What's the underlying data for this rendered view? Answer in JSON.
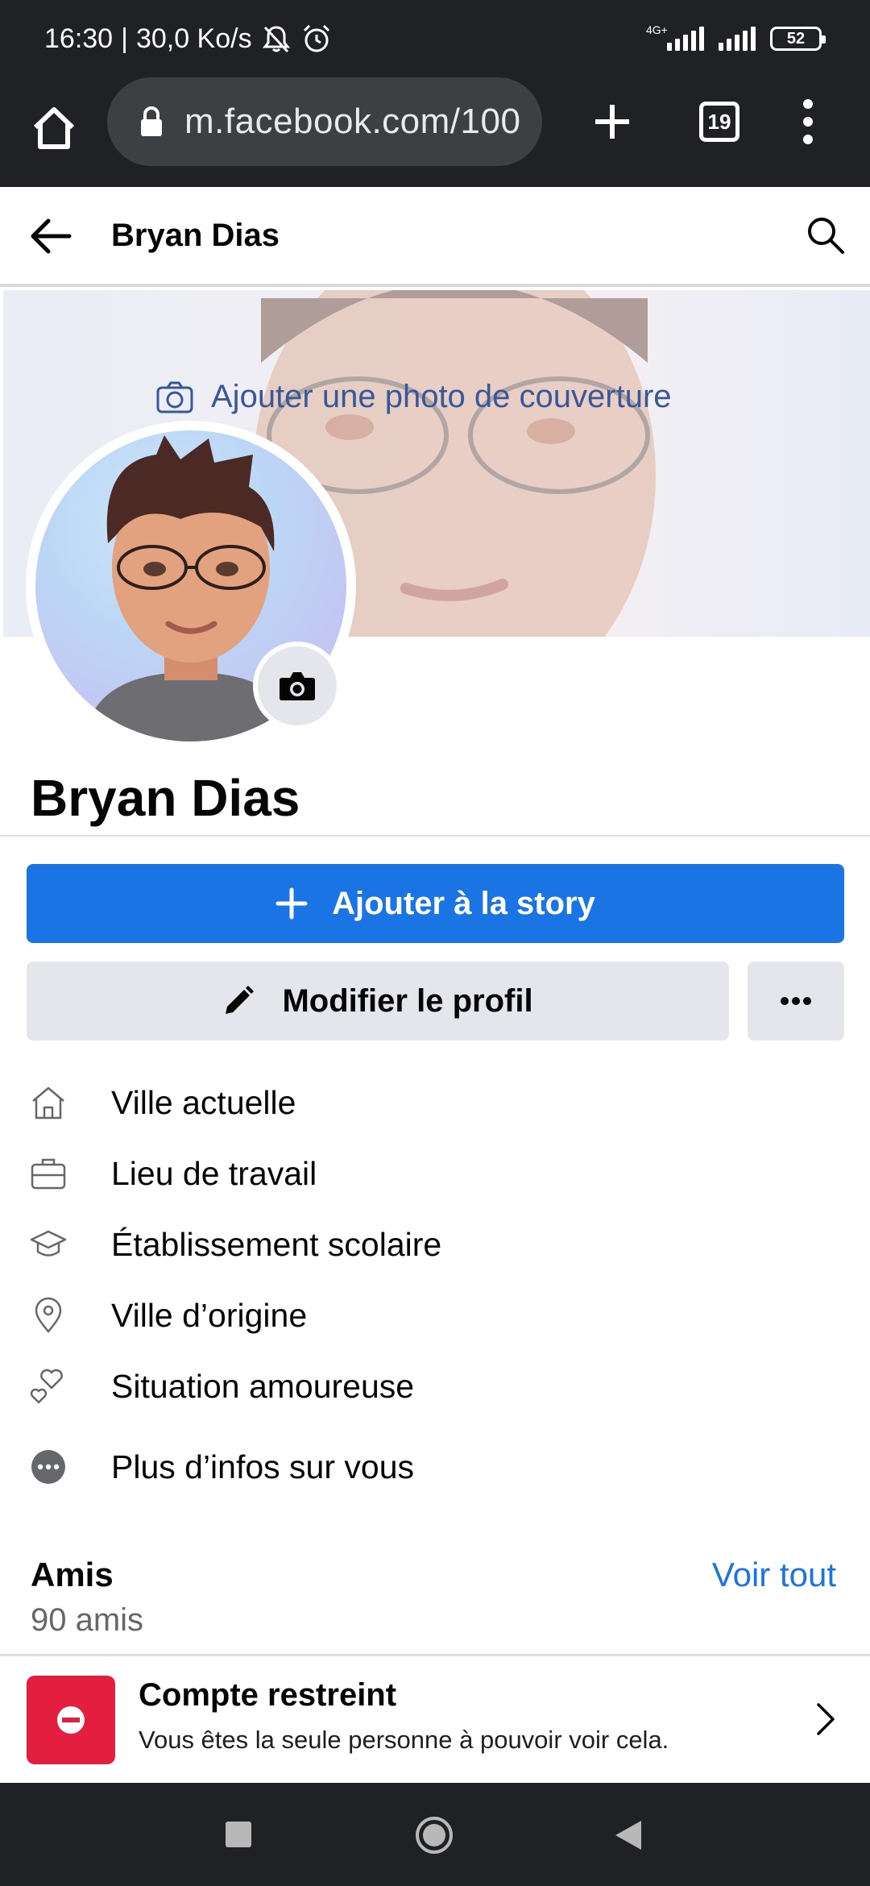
{
  "status_bar": {
    "time": "16:30",
    "separator": "|",
    "speed": "30,0 Ko/s",
    "network_type": "4G+",
    "battery": "52"
  },
  "browser": {
    "url": "m.facebook.com/100",
    "tab_count": "19"
  },
  "header": {
    "title": "Bryan Dias"
  },
  "cover": {
    "add_cover_label": "Ajouter une photo de couverture"
  },
  "profile": {
    "name": "Bryan Dias"
  },
  "actions": {
    "story_label": "Ajouter à la story",
    "edit_label": "Modifier le profil"
  },
  "intro": {
    "items": [
      {
        "label": "Ville actuelle",
        "icon": "house-icon"
      },
      {
        "label": "Lieu de travail",
        "icon": "briefcase-icon"
      },
      {
        "label": "Établissement scolaire",
        "icon": "graduation-cap-icon"
      },
      {
        "label": "Ville d’origine",
        "icon": "location-pin-icon"
      },
      {
        "label": "Situation amoureuse",
        "icon": "hearts-icon"
      },
      {
        "label": "Plus d’infos sur vous",
        "icon": "more-dots-icon"
      }
    ]
  },
  "friends": {
    "title": "Amis",
    "see_all": "Voir tout",
    "count": "90 amis"
  },
  "restricted": {
    "title": "Compte restreint",
    "description": "Vous êtes la seule personne à pouvoir voir cela."
  },
  "colors": {
    "primary_blue": "#1b74e4",
    "restricted_red": "#e41e3f",
    "cover_link": "#385898",
    "dark_bar": "#202124"
  }
}
